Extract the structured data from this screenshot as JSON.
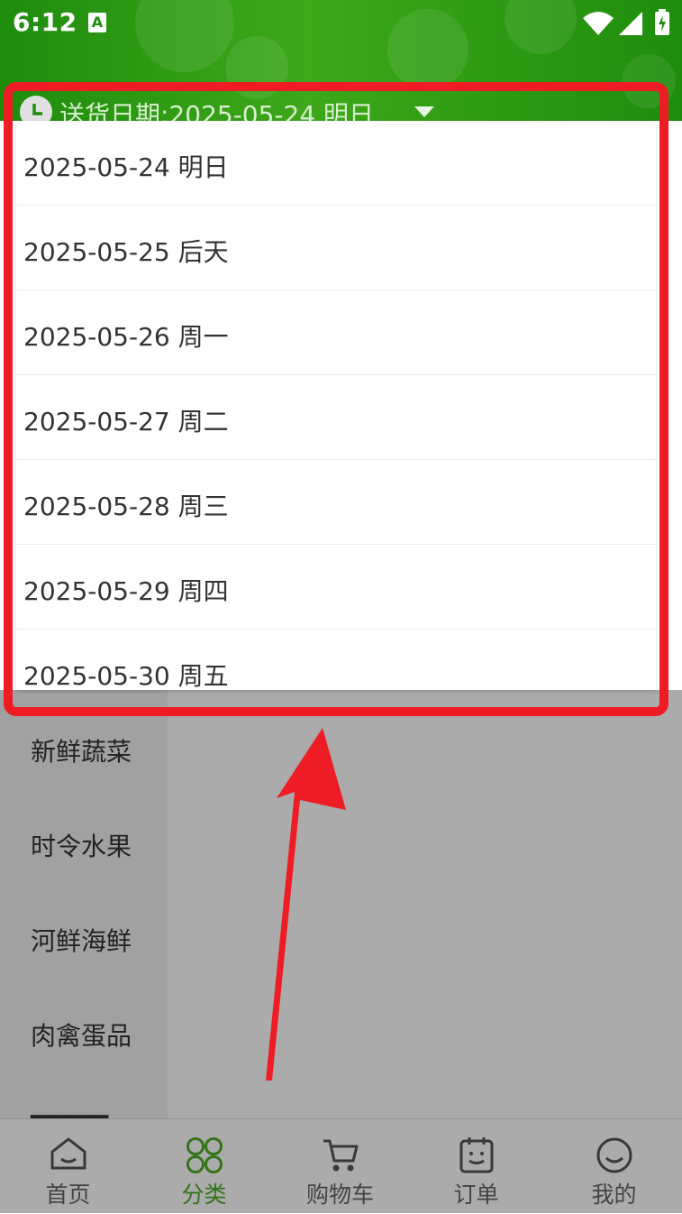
{
  "status_bar": {
    "time": "6:12",
    "notification_icon_label": "A"
  },
  "header": {
    "delivery_date_label": "送货日期:2025-05-24 明日"
  },
  "date_options": [
    "2025-05-24 明日",
    "2025-05-25 后天",
    "2025-05-26 周一",
    "2025-05-27 周二",
    "2025-05-28 周三",
    "2025-05-29 周四",
    "2025-05-30 周五"
  ],
  "categories": [
    "新鲜蔬菜",
    "时令水果",
    "河鲜海鲜",
    "肉禽蛋品"
  ],
  "bottom_nav": [
    {
      "label": "首页",
      "icon": "home-icon"
    },
    {
      "label": "分类",
      "icon": "category-icon"
    },
    {
      "label": "购物车",
      "icon": "cart-icon"
    },
    {
      "label": "订单",
      "icon": "orders-icon"
    },
    {
      "label": "我的",
      "icon": "profile-icon"
    }
  ],
  "colors": {
    "brand_green": "#2a9a12",
    "active_nav": "#4cae26",
    "annotation_red": "#ee1c25"
  }
}
